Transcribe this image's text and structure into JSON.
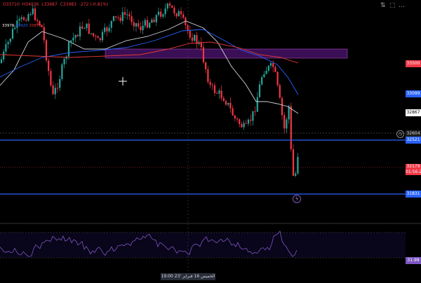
{
  "legend": {
    "open": "O33710",
    "high": "H34036",
    "low": "L33687",
    "close": "C33983",
    "change": "-272 (-0.81%)",
    "ma_values": [
      "33976",
      "33920",
      "33878"
    ]
  },
  "top_buttons": [
    "⇅",
    "⬚",
    "…"
  ],
  "price_labels": {
    "p33500": "33500",
    "p33099": "33099",
    "p32867": "32867",
    "p32604": "32604",
    "p32521": "32521",
    "p32179": "32179",
    "countdown": "01:56:21",
    "p31831": "31831",
    "rsi": "31.99"
  },
  "crosshair_time": "الخميس 16 فبراير '23   19:00",
  "icons": {
    "clock": "clock-icon",
    "lightning": "lightning-icon",
    "crosshair": "crosshair-icon"
  },
  "colors": {
    "up": "#26a69a",
    "down": "#f23645",
    "zone": "#6a1b9a",
    "ma_white": "#d1d4dc",
    "ma_blue": "#2962ff",
    "ma_red": "#e53935",
    "rsi": "#7e57c2",
    "hline": "#2962ff"
  }
}
